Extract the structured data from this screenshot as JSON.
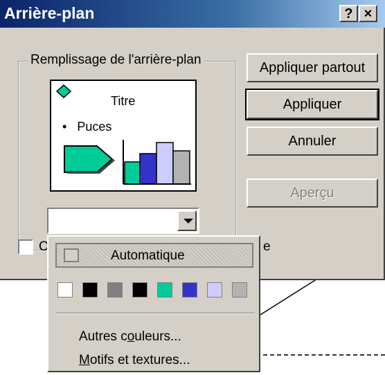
{
  "window": {
    "title": "Arrière-plan",
    "help_button": "?",
    "close_button": "×"
  },
  "fill_group": {
    "label": "Remplissage de l'arrière-plan",
    "preview": {
      "title": "Titre",
      "bullet_marker": "•",
      "bullet_text": "Puces"
    },
    "color_combo_value": ""
  },
  "buttons": {
    "apply_all": "Appliquer partout",
    "apply": "Appliquer",
    "cancel": "Annuler",
    "preview": "Aperçu"
  },
  "checkbox": {
    "visible_start": "O",
    "visible_end": "e",
    "checked": false
  },
  "dropdown": {
    "automatic": "Automatique",
    "more_colors_underlined": "o",
    "more_colors_prefix": "Autres c",
    "more_colors_suffix": "uleurs...",
    "patterns_underlined": "M",
    "patterns_suffix": "otifs et textures...",
    "palette": [
      "#ffffff",
      "#000000",
      "#808080",
      "#000000",
      "#00cc99",
      "#3333cc",
      "#ccccff",
      "#b2b2b2"
    ]
  },
  "colors": {
    "title_bar": "#0a246a",
    "dialog_face": "#d4d0c8",
    "preview_shape": "#00cc99",
    "bar_blue": "#3333cc",
    "bar_lavender": "#ccccff",
    "bar_gray": "#b2b2b2"
  }
}
